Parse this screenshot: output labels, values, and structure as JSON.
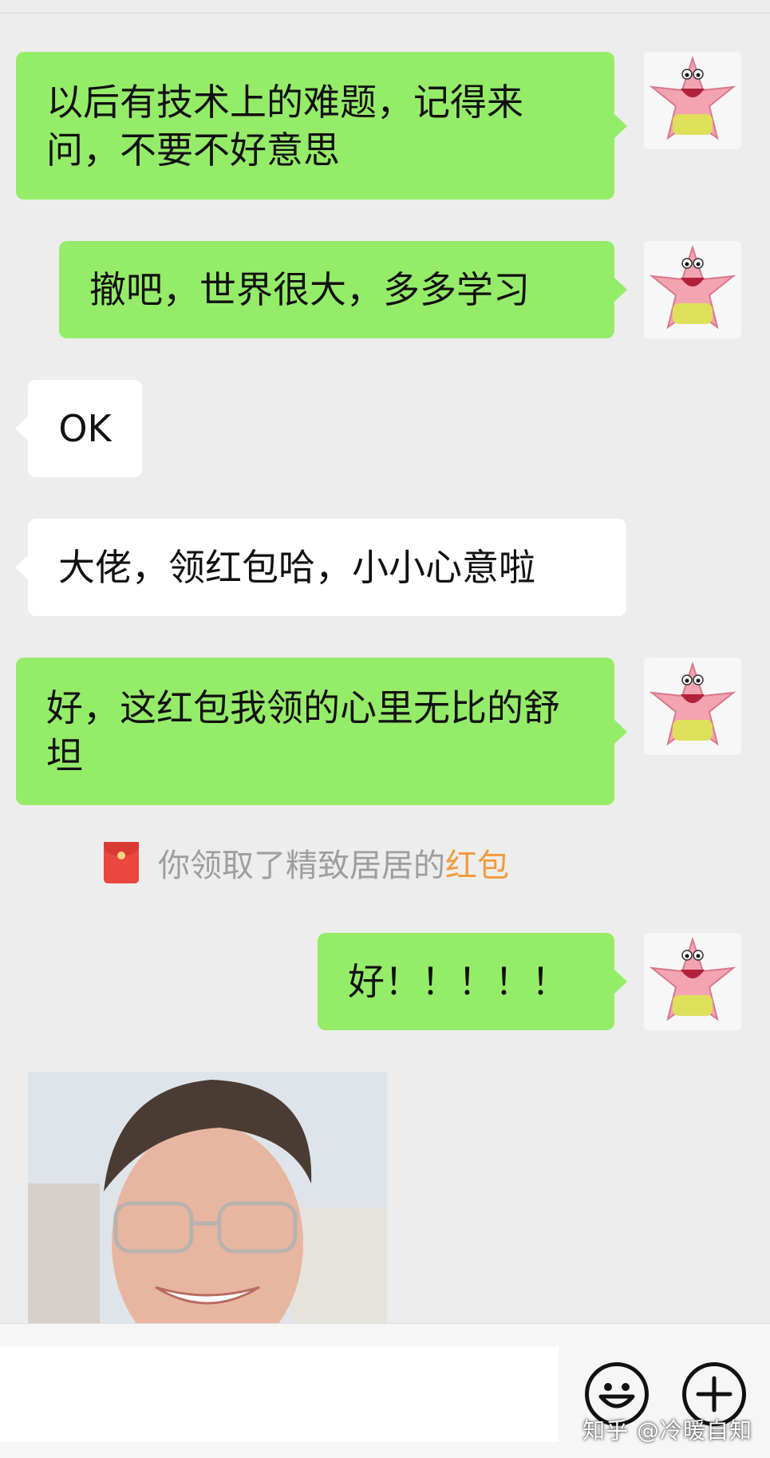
{
  "messages": [
    {
      "id": "m1",
      "side": "me",
      "text": "以后有技术上的难题，记得来问，不要不好意思"
    },
    {
      "id": "m2",
      "side": "me",
      "text": "撤吧，世界很大，多多学习"
    },
    {
      "id": "m3",
      "side": "other",
      "text": "OK"
    },
    {
      "id": "m4",
      "side": "other",
      "text": "大佬，领红包哈，小小心意啦"
    },
    {
      "id": "m5",
      "side": "me",
      "text": "好，这红包我领的心里无比的舒坦"
    },
    {
      "id": "m7",
      "side": "me",
      "text": "好！！！！！"
    }
  ],
  "system_notice": {
    "prefix": "你领取了精致居居的",
    "link": "红包",
    "icon": "red-packet-icon"
  },
  "photo": {
    "icon": "photo-message"
  },
  "input_bar": {
    "placeholder": "",
    "value": "",
    "emoji_icon": "smiley-face-icon",
    "plus_icon": "plus-circle-icon"
  },
  "watermark": {
    "text": "知乎 @冷暖自知"
  },
  "colors": {
    "background": "#ededed",
    "my_bubble": "#95ec69",
    "other_bubble": "#ffffff",
    "system_text": "#9e9e9e",
    "link": "#f59a3b"
  }
}
